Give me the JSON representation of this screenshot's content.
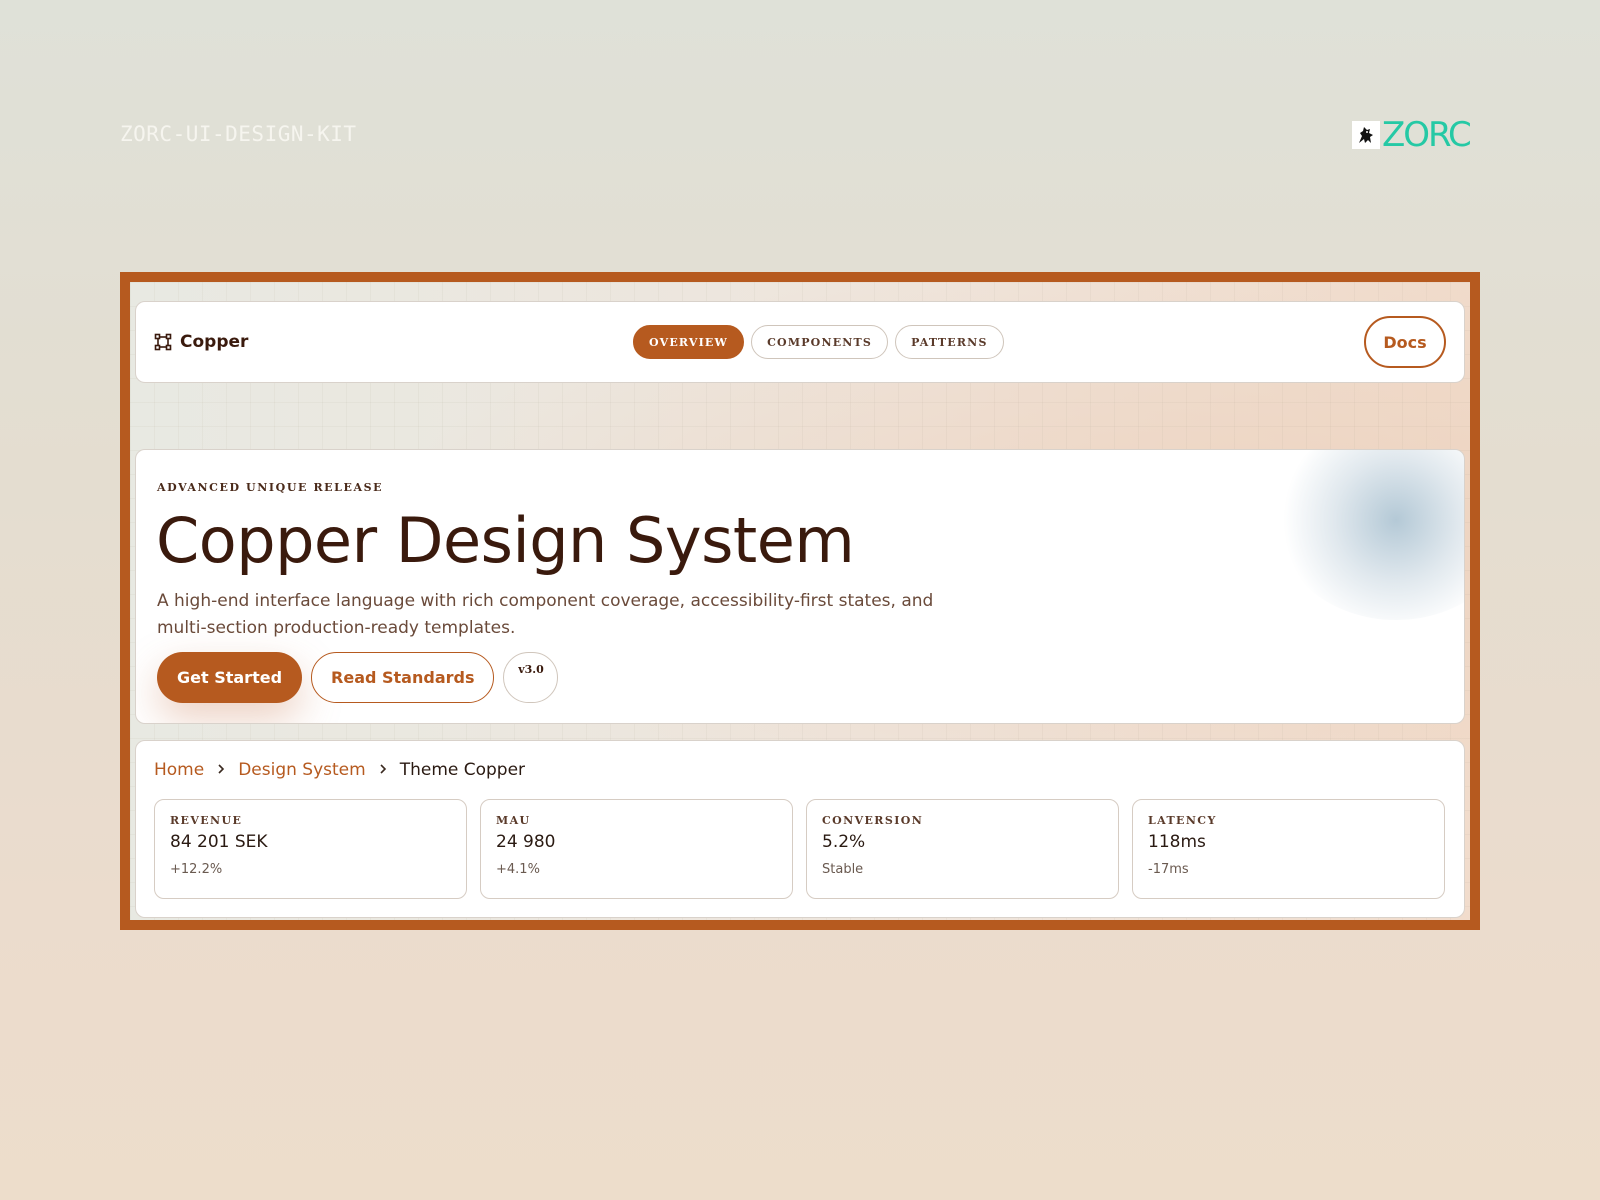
{
  "page": {
    "kit_label": "ZORC-UI-DESIGN-KIT",
    "brand_word": "ZORC"
  },
  "header": {
    "logo_text": "Copper",
    "nav": [
      {
        "label": "OVERVIEW",
        "active": true
      },
      {
        "label": "COMPONENTS",
        "active": false
      },
      {
        "label": "PATTERNS",
        "active": false
      }
    ],
    "docs_label": "Docs"
  },
  "hero": {
    "eyebrow": "ADVANCED UNIQUE RELEASE",
    "title": "Copper Design System",
    "description": "A high-end interface language with rich component coverage, accessibility-first states, and multi-section production-ready templates.",
    "primary_button": "Get Started",
    "secondary_button": "Read Standards",
    "version_badge": "v3.0"
  },
  "breadcrumb": {
    "items": [
      "Home",
      "Design System",
      "Theme Copper"
    ]
  },
  "metrics": [
    {
      "label": "REVENUE",
      "value": "84 201 SEK",
      "delta": "+12.2%"
    },
    {
      "label": "MAU",
      "value": "24 980",
      "delta": "+4.1%"
    },
    {
      "label": "CONVERSION",
      "value": "5.2%",
      "delta": "Stable"
    },
    {
      "label": "LATENCY",
      "value": "118ms",
      "delta": "-17ms"
    }
  ],
  "colors": {
    "accent": "#b65a1f",
    "brand_green": "#25c9a5",
    "heading": "#3a1a0d"
  },
  "icons": {
    "brand_mascot": "mascot-icon",
    "copper_logo": "frame-corners-icon",
    "breadcrumb_separator": "chevron-right-icon"
  }
}
